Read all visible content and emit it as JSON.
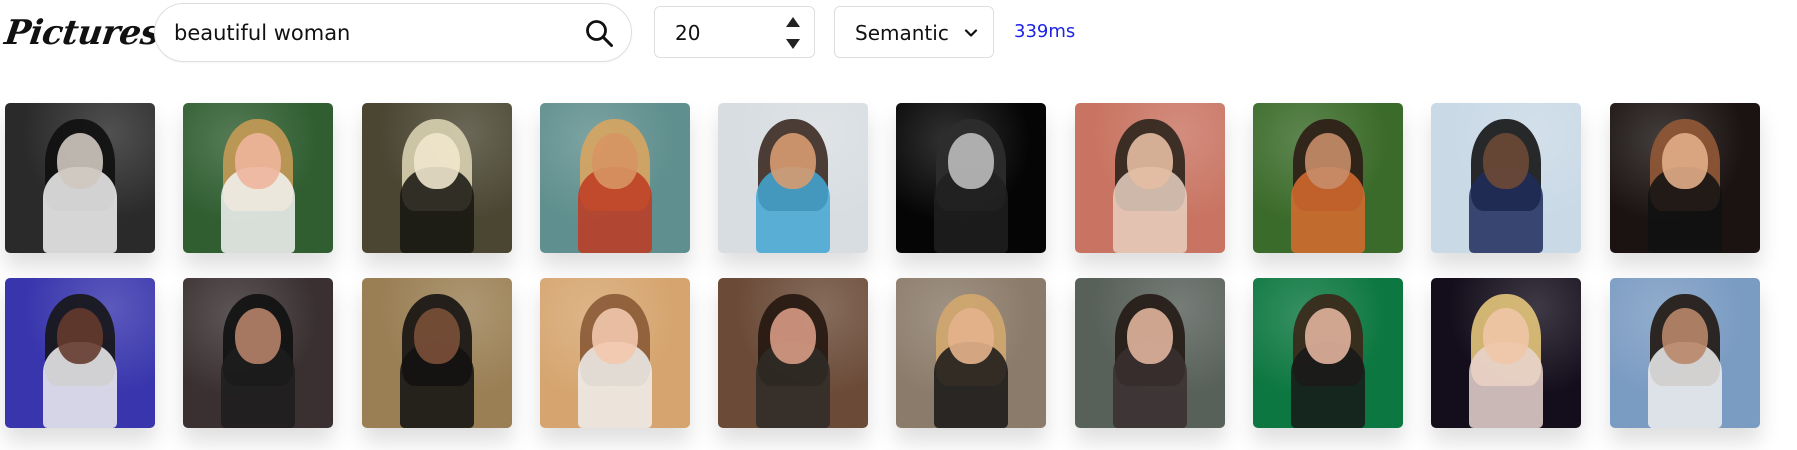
{
  "app": {
    "title": "Pictures"
  },
  "search": {
    "value": "beautiful woman",
    "placeholder": "",
    "icon": "search-icon"
  },
  "count": {
    "value": "20",
    "up_icon": "triangle-up-icon",
    "down_icon": "triangle-down-icon"
  },
  "mode": {
    "selected": "Semantic",
    "icon": "chevron-down-icon"
  },
  "timing": {
    "label": "339ms"
  },
  "colors": {
    "accent_timing": "#1d23e6",
    "border": "#dedede"
  },
  "thumbnails": [
    {
      "bg": "#2a2a2a",
      "hair": "#101010",
      "face": "#cfc8c0",
      "figure": "#f2f2f2"
    },
    {
      "bg": "#305e31",
      "hair": "#c79a55",
      "face": "#f0b59c",
      "figure": "#f4f4f4"
    },
    {
      "bg": "#4a4632",
      "hair": "#d8d0b0",
      "face": "#f0e6cd",
      "figure": "#171610"
    },
    {
      "bg": "#5f8f8e",
      "hair": "#d8a561",
      "face": "#d79563",
      "figure": "#bf3b23"
    },
    {
      "bg": "#d8dde1",
      "hair": "#3b2a22",
      "face": "#d79b70",
      "figure": "#44a6d4"
    },
    {
      "bg": "#050505",
      "hair": "#2e2e2e",
      "face": "#bdbdbd",
      "figure": "#1f1f1f"
    },
    {
      "bg": "#c97462",
      "hair": "#2c251d",
      "face": "#e4bca2",
      "figure": "#e7cfbf"
    },
    {
      "bg": "#3b6b2a",
      "hair": "#2d1c16",
      "face": "#c88e69",
      "figure": "#d86b2f"
    },
    {
      "bg": "#c9d9e6",
      "hair": "#141414",
      "face": "#6d4935",
      "figure": "#1f2c5c"
    },
    {
      "bg": "#1a1312",
      "hair": "#925936",
      "face": "#e2ad88",
      "figure": "#111111"
    },
    {
      "bg": "#3835ad",
      "hair": "#161616",
      "face": "#653b2d",
      "figure": "#f0f0f0"
    },
    {
      "bg": "#3a3031",
      "hair": "#111111",
      "face": "#b78369",
      "figure": "#1d1d1d"
    },
    {
      "bg": "#9a7f54",
      "hair": "#161312",
      "face": "#7b5038",
      "figure": "#111111"
    },
    {
      "bg": "#d6a56f",
      "hair": "#8a5a36",
      "face": "#f2c8ad",
      "figure": "#f0efec"
    },
    {
      "bg": "#6b4b38",
      "hair": "#24160f",
      "face": "#d79b84",
      "figure": "#2f2b26"
    },
    {
      "bg": "#8b7b6a",
      "hair": "#d3a76e",
      "face": "#e6b28c",
      "figure": "#181818"
    },
    {
      "bg": "#58605a",
      "hair": "#241a14",
      "face": "#e0b49c",
      "figure": "#3a3030"
    },
    {
      "bg": "#0c7740",
      "hair": "#3b2619",
      "face": "#e2b49d",
      "figure": "#171818"
    },
    {
      "bg": "#140e1c",
      "hair": "#e4c57b",
      "face": "#efc5a7",
      "figure": "#e9d4cf"
    },
    {
      "bg": "#7a9bc2",
      "hair": "#211711",
      "face": "#b9876a",
      "figure": "#eeeeee"
    }
  ]
}
